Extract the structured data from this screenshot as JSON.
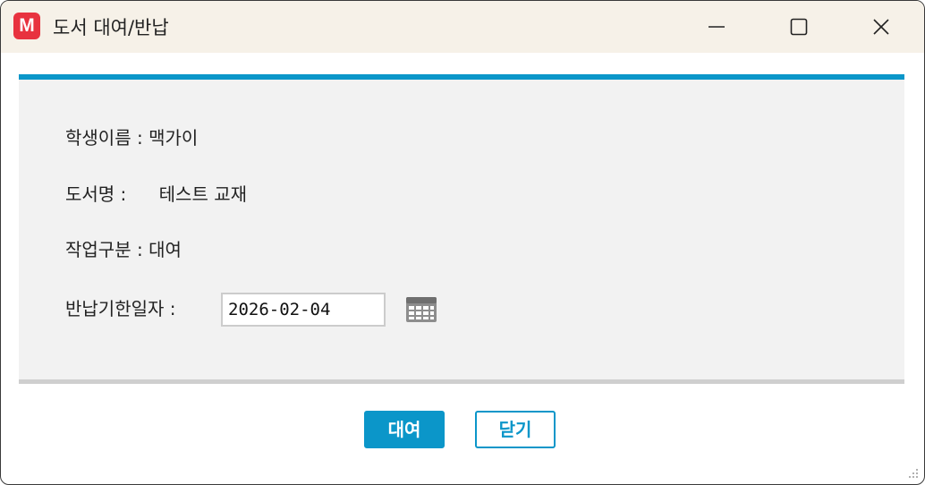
{
  "window": {
    "app_icon_letter": "M",
    "title": "도서 대여/반납",
    "icons": {
      "minimize": "minimize-icon",
      "maximize": "maximize-icon",
      "close": "close-icon"
    }
  },
  "form": {
    "student_name_label": "학생이름 :",
    "student_name_value": "맥가이",
    "book_title_label": "도서명 :",
    "book_title_value": "테스트 교재",
    "task_type_label": "작업구분 :",
    "task_type_value": "대여",
    "due_date_label": "반납기한일자 :",
    "due_date_value": "2026-02-04",
    "calendar_icon": "calendar-icon"
  },
  "buttons": {
    "rent": "대여",
    "close": "닫기"
  },
  "colors": {
    "accent": "#0b96c9",
    "app_icon": "#e8323f",
    "titlebar": "#f6f1e8",
    "panel": "#f2f2f2"
  }
}
